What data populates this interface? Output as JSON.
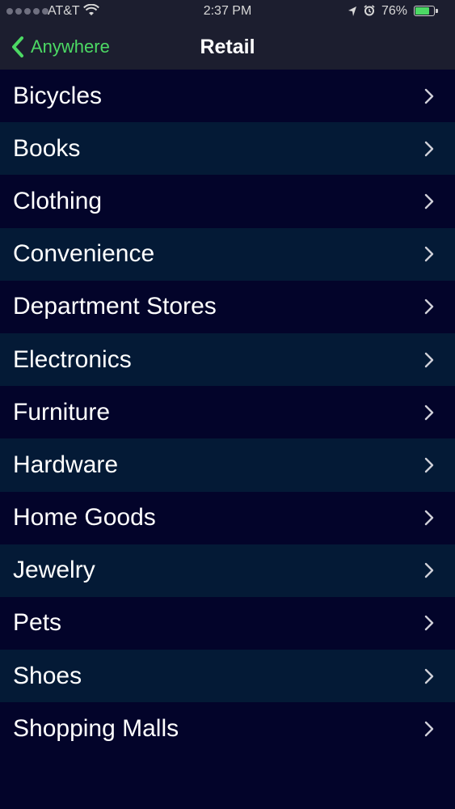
{
  "status_bar": {
    "carrier": "AT&T",
    "time": "2:37 PM",
    "battery_percent": "76%",
    "battery_level": 0.76,
    "battery_color": "#4cd964"
  },
  "nav": {
    "back_label": "Anywhere",
    "title": "Retail",
    "accent_color": "#4cd964"
  },
  "list": {
    "items": [
      {
        "label": "Bicycles"
      },
      {
        "label": "Books"
      },
      {
        "label": "Clothing"
      },
      {
        "label": "Convenience"
      },
      {
        "label": "Department Stores"
      },
      {
        "label": "Electronics"
      },
      {
        "label": "Furniture"
      },
      {
        "label": "Hardware"
      },
      {
        "label": "Home Goods"
      },
      {
        "label": "Jewelry"
      },
      {
        "label": "Pets"
      },
      {
        "label": "Shoes"
      },
      {
        "label": "Shopping Malls"
      }
    ]
  },
  "icons": {
    "back": "chevron-left-icon",
    "row_disclosure": "chevron-right-icon",
    "wifi": "wifi-icon",
    "location": "location-arrow-icon",
    "alarm": "alarm-icon",
    "battery": "battery-icon"
  }
}
